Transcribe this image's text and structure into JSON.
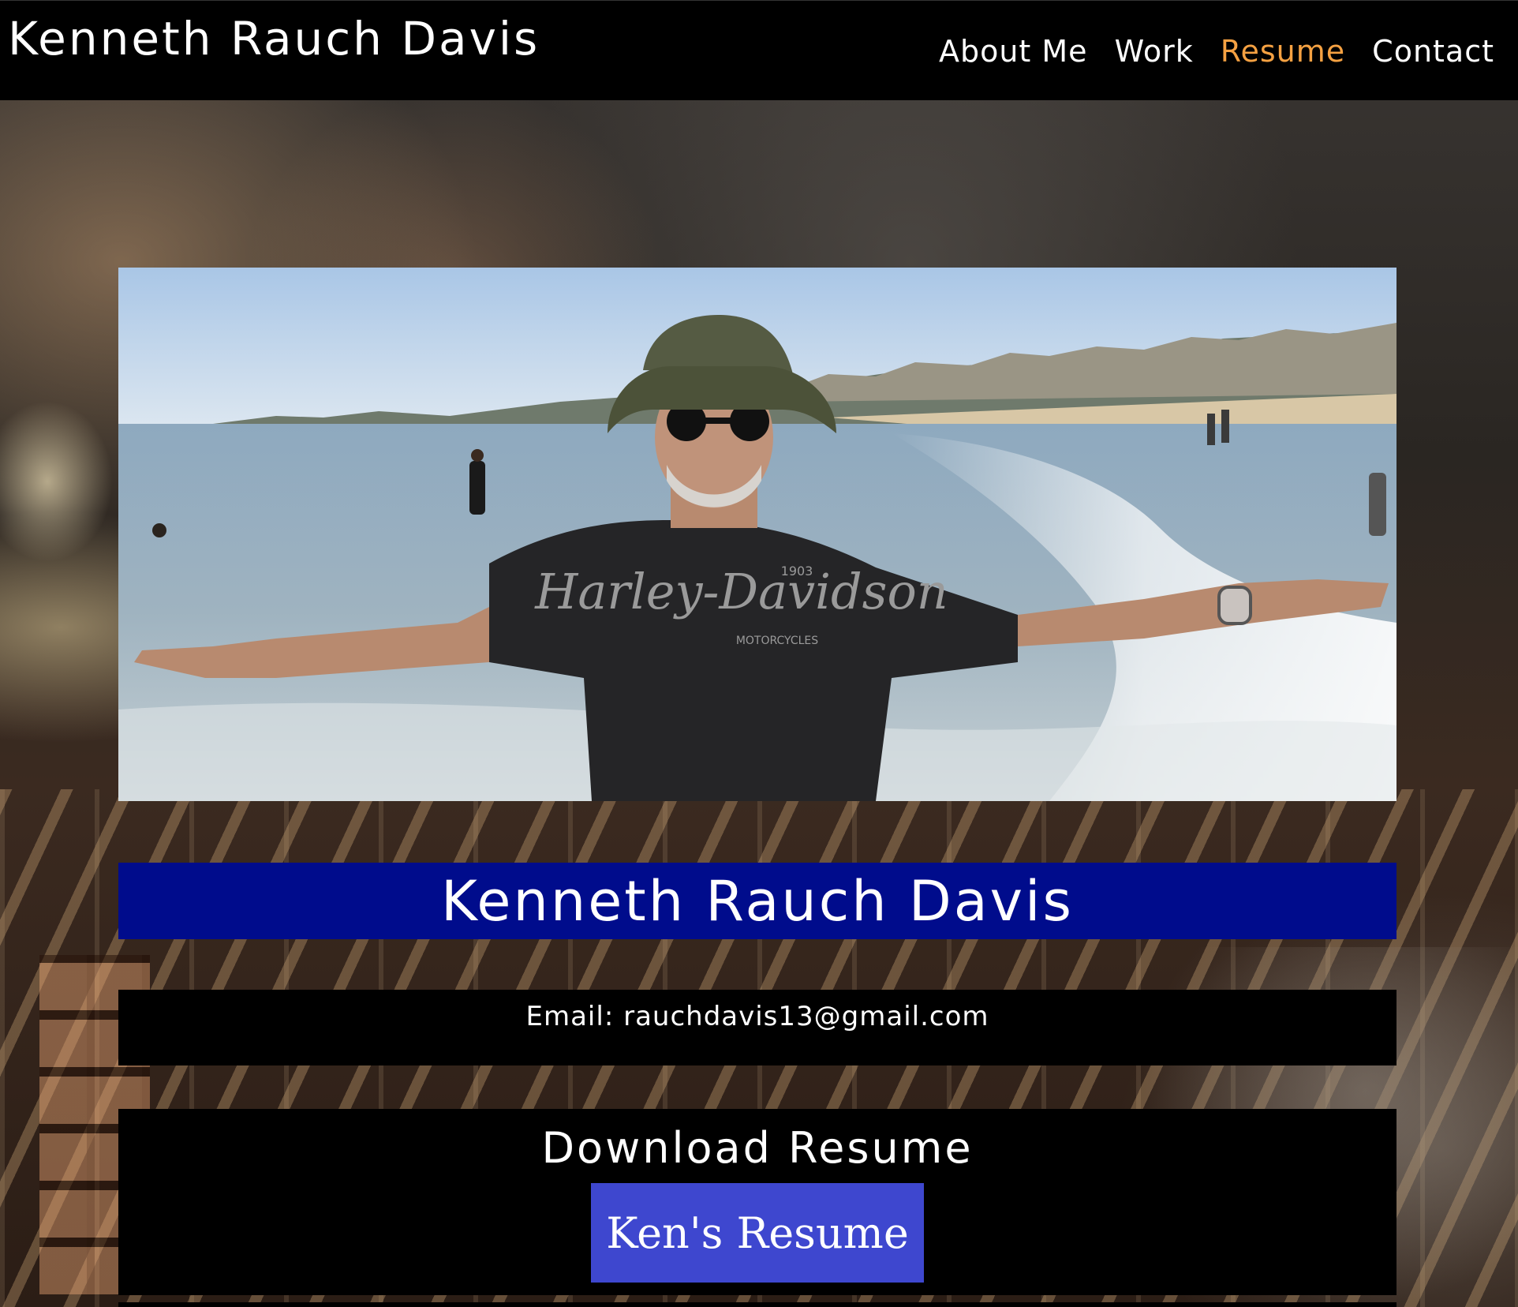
{
  "header": {
    "brand": "Kenneth Rauch Davis",
    "nav": [
      {
        "label": "About Me",
        "active": false
      },
      {
        "label": "Work",
        "active": false
      },
      {
        "label": "Resume",
        "active": true
      },
      {
        "label": "Contact",
        "active": false
      }
    ],
    "active_color": "#f5a142"
  },
  "hero": {
    "shirt_text": "Harley-Davidson",
    "shirt_subtext": "MOTORCYCLES",
    "shirt_year": "1903"
  },
  "banner": {
    "name": "Kenneth Rauch Davis",
    "background_color": "#000c8c"
  },
  "contact": {
    "email_label": "Email:",
    "email": "rauchdavis13@gmail.com"
  },
  "download": {
    "heading": "Download Resume",
    "button_label": "Ken's Resume",
    "button_color": "#3e47cf"
  }
}
